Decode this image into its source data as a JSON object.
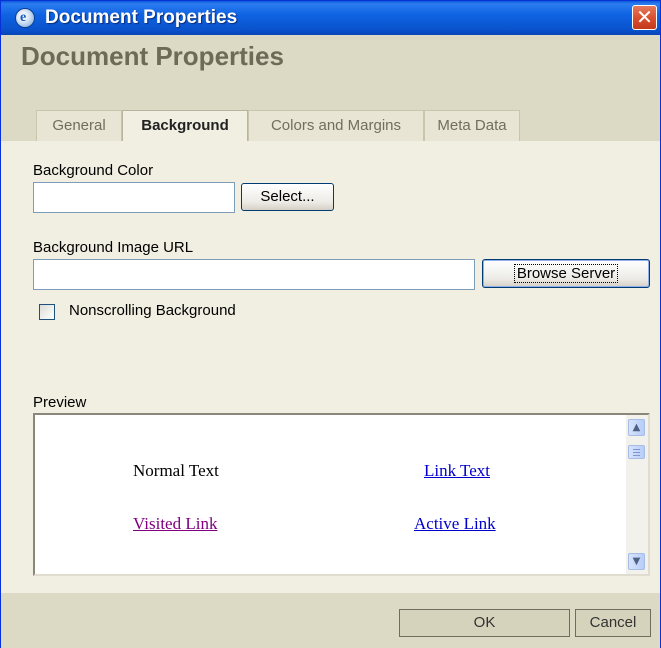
{
  "window": {
    "title": "Document Properties",
    "close_glyph": "✕"
  },
  "header": {
    "title": "Document Properties"
  },
  "tabs": [
    {
      "label": "General",
      "active": false
    },
    {
      "label": "Background",
      "active": true
    },
    {
      "label": "Colors and Margins",
      "active": false
    },
    {
      "label": "Meta Data",
      "active": false
    }
  ],
  "background": {
    "color_label": "Background Color",
    "color_value": "",
    "select_button": "Select...",
    "image_url_label": "Background Image URL",
    "image_url_value": "",
    "browse_button": "Browse Server",
    "nonscrolling_label": "Nonscrolling Background",
    "nonscrolling_checked": false
  },
  "preview": {
    "label": "Preview",
    "normal_text": "Normal Text",
    "link_text": "Link Text",
    "visited_link": "Visited Link",
    "active_link": "Active Link"
  },
  "footer": {
    "ok_label": "OK",
    "cancel_label": "Cancel"
  },
  "colors": {
    "titlebar": "#0a52cc",
    "link": "#0000cc",
    "visited": "#800080",
    "panel": "#f1efe2"
  },
  "icons": {
    "app": "ie-document-icon",
    "close": "close-icon",
    "scroll_up": "scroll-up-icon",
    "scroll_down": "scroll-down-icon"
  }
}
